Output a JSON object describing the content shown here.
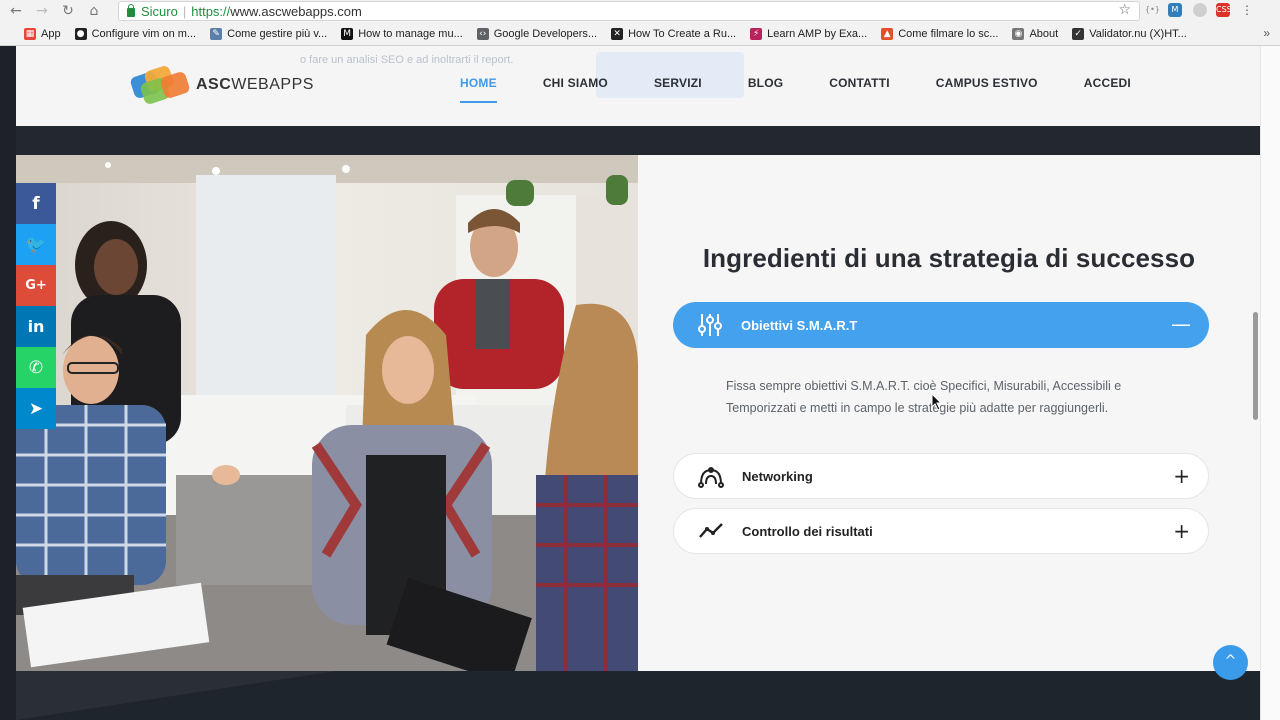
{
  "browser": {
    "secure_label": "Sicuro",
    "url_scheme": "https://",
    "url_host": "www.ascwebapps.com",
    "bookmarks": [
      {
        "label": "App",
        "icon": "apps-grid-icon",
        "color": "#e8453c"
      },
      {
        "label": "Configure vim on m...",
        "icon": "github-icon",
        "color": "#222222"
      },
      {
        "label": "Come gestire più v...",
        "icon": "pen-icon",
        "color": "#5b7fa8"
      },
      {
        "label": "How to manage mu...",
        "icon": "medium-icon",
        "color": "#111111"
      },
      {
        "label": "Google Developers...",
        "icon": "code-icon",
        "color": "#5f6368"
      },
      {
        "label": "How To Create a Ru...",
        "icon": "cross-icon",
        "color": "#222222"
      },
      {
        "label": "Learn AMP by Exa...",
        "icon": "amp-icon",
        "color": "#b7245c"
      },
      {
        "label": "Come filmare lo sc...",
        "icon": "triangle-icon",
        "color": "#e0502d"
      },
      {
        "label": "About",
        "icon": "shield-icon",
        "color": "#777777"
      },
      {
        "label": "Validator.nu (X)HT...",
        "icon": "validator-icon",
        "color": "#333333"
      }
    ]
  },
  "header": {
    "ghost_text": "o fare un analisi SEO e ad inoltrarti il report.",
    "logo_prefix": "ASC",
    "logo_suffix": "WEBAPPS",
    "nav": [
      "HOME",
      "CHI SIAMO",
      "SERVIZI",
      "BLOG",
      "CONTATTI",
      "CAMPUS ESTIVO",
      "ACCEDI"
    ],
    "active_nav": "HOME",
    "accent": "#4099ea"
  },
  "main": {
    "heading": "Ingredienti di una strategia di successo",
    "accordion": [
      {
        "title": "Obiettivi S.M.A.R.T",
        "icon": "sliders-icon",
        "toggle": "—",
        "expanded": true,
        "body": "Fissa sempre obiettivi S.M.A.R.T. cioè Specifici, Misurabili, Accessibili e Temporizzati e metti in campo le strategie più adatte per raggiungerli."
      },
      {
        "title": "Networking",
        "icon": "network-icon",
        "toggle": "+",
        "expanded": false
      },
      {
        "title": "Controllo dei risultati",
        "icon": "trend-line-icon",
        "toggle": "+",
        "expanded": false
      }
    ]
  },
  "social": [
    {
      "name": "facebook",
      "glyph": "f",
      "color": "#3b5998"
    },
    {
      "name": "twitter",
      "glyph": "🐦",
      "color": "#1da1f2"
    },
    {
      "name": "google-plus",
      "glyph": "G+",
      "color": "#dd4b39"
    },
    {
      "name": "linkedin",
      "glyph": "in",
      "color": "#0077b5"
    },
    {
      "name": "whatsapp",
      "glyph": "✆",
      "color": "#25d366"
    },
    {
      "name": "telegram",
      "glyph": "➤",
      "color": "#0088cc"
    }
  ],
  "scroll_top": "^"
}
